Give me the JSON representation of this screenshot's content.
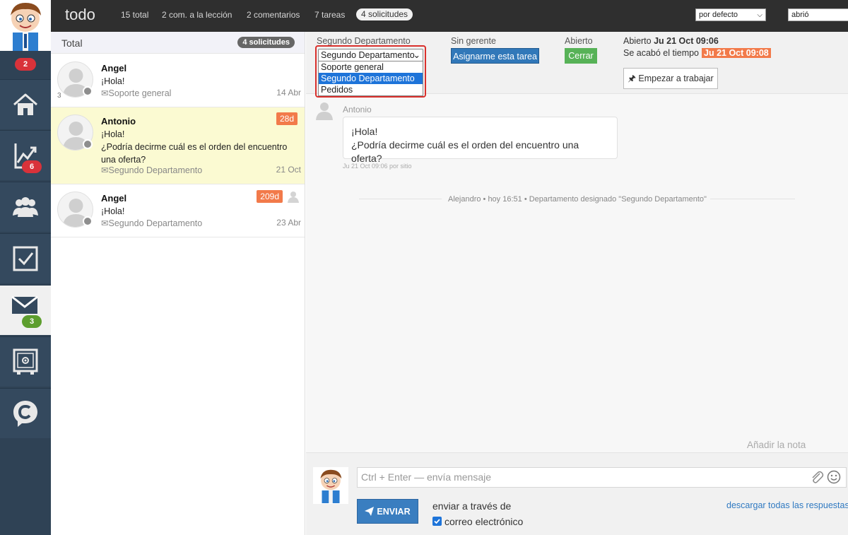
{
  "sidebar": {
    "top_badge": "2",
    "items": [
      {
        "name": "home",
        "badge": ""
      },
      {
        "name": "stats",
        "badge": "6"
      },
      {
        "name": "clients",
        "badge": ""
      },
      {
        "name": "tasks",
        "badge": ""
      },
      {
        "name": "mail",
        "badge": "3"
      },
      {
        "name": "safe",
        "badge": ""
      },
      {
        "name": "chat",
        "badge": ""
      }
    ]
  },
  "topbar": {
    "title": "todo",
    "links": [
      "15 total",
      "2 com. a la lección",
      "2 comentarios",
      "7 tareas"
    ],
    "active_tab": "4 solicitudes",
    "sort_select": "por defecto",
    "status_select": "abrió"
  },
  "list": {
    "header_title": "Total",
    "header_badge": "4 solicitudes",
    "conversations": [
      {
        "name": "Angel",
        "lines": [
          "¡Hola!"
        ],
        "department": "Soporte general",
        "date": "14 Abr",
        "age": "",
        "count": "3"
      },
      {
        "name": "Antonio",
        "lines": [
          "¡Hola!",
          "¿Podría decirme cuál es el orden del encuentro una oferta?"
        ],
        "department": "Segundo Departamento",
        "date": "21 Oct",
        "age": "28d",
        "count": ""
      },
      {
        "name": "Angel",
        "lines": [
          "¡Hola!"
        ],
        "department": "Segundo Departamento",
        "date": "23 Abr",
        "age": "209d",
        "count": ""
      }
    ]
  },
  "header": {
    "department_label": "Segundo Departamento",
    "department_selected": "Segundo Departamento",
    "department_options": [
      "Soporte general",
      "Segundo Departamento",
      "Pedidos"
    ],
    "manager_label": "Sin gerente",
    "assign_button": "Asignarme esta tarea",
    "state_label": "Abierto",
    "close_button": "Cerrar",
    "opened_prefix": "Abierto",
    "opened_date": "Ju 21 Oct 09:06",
    "expired_prefix": "Se acabó el tiempo",
    "expired_date": "Ju 21 Oct 09:08",
    "work_button": "Empezar a trabajar"
  },
  "messages": {
    "author": "Antonio",
    "line1": "¡Hola!",
    "line2": "¿Podría decirme cuál es el orden del encuentro una oferta?",
    "meta": "Ju 21 Oct 09:06 por sitio",
    "system": "Alejandro • hoy 16:51 • Departamento designado \"Segundo Departamento\"",
    "add_note": "Añadir la nota"
  },
  "composer": {
    "placeholder": "Ctrl + Enter — envía mensaje",
    "send_button": "ENVIAR",
    "via_label": "enviar a través de",
    "via_option": "correo electrónico",
    "download_link": "descargar todas las respuestas"
  },
  "colors": {
    "sidebar": "#34495e",
    "badge_red": "#d9323a",
    "badge_green": "#5d9e2e",
    "age_orange": "#f27a4a",
    "assign_blue": "#3178b9",
    "close_green": "#57b257",
    "highlight_red": "#d9302c"
  }
}
